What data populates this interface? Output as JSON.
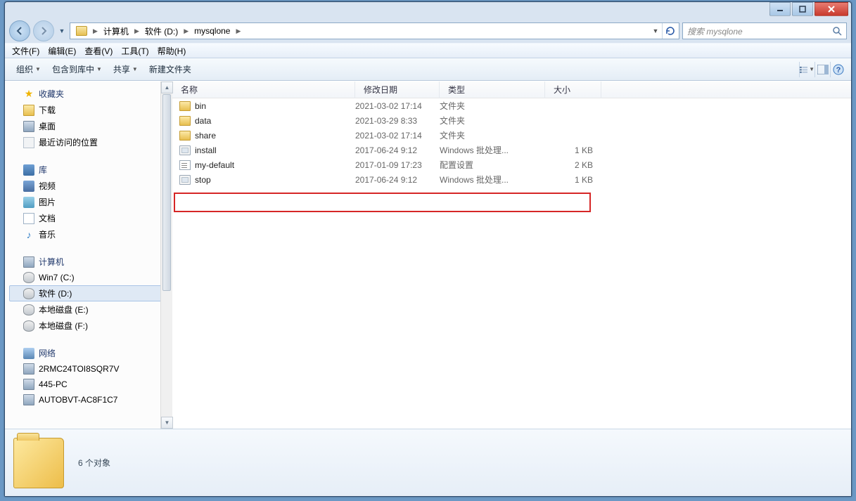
{
  "window": {
    "min": "—",
    "max": "☐",
    "close": "✕"
  },
  "nav": {
    "back": "◄",
    "fwd": "►"
  },
  "addr": {
    "root": "计算机",
    "drive": "软件 (D:)",
    "folder": "mysqlone"
  },
  "search": {
    "placeholder": "搜索 mysqlone"
  },
  "menu": {
    "file": "文件(F)",
    "edit": "编辑(E)",
    "view": "查看(V)",
    "tools": "工具(T)",
    "help": "帮助(H)"
  },
  "toolbar": {
    "organize": "组织",
    "include": "包含到库中",
    "share": "共享",
    "newfolder": "新建文件夹"
  },
  "sidebar": {
    "favorites": "收藏夹",
    "downloads": "下载",
    "desktop": "桌面",
    "recent": "最近访问的位置",
    "library": "库",
    "videos": "视频",
    "pictures": "图片",
    "documents": "文档",
    "music": "音乐",
    "computer": "计算机",
    "win7": "Win7 (C:)",
    "soft": "软件 (D:)",
    "local_e": "本地磁盘 (E:)",
    "local_f": "本地磁盘 (F:)",
    "network": "网络",
    "net1": "2RMC24TOI8SQR7V",
    "net2": "445-PC",
    "net3": "AUTOBVT-AC8F1C7"
  },
  "cols": {
    "name": "名称",
    "date": "修改日期",
    "type": "类型",
    "size": "大小"
  },
  "rows": [
    {
      "icon": "folder",
      "name": "bin",
      "date": "2021-03-02 17:14",
      "type": "文件夹",
      "size": ""
    },
    {
      "icon": "folder",
      "name": "data",
      "date": "2021-03-29 8:33",
      "type": "文件夹",
      "size": ""
    },
    {
      "icon": "folder",
      "name": "share",
      "date": "2021-03-02 17:14",
      "type": "文件夹",
      "size": ""
    },
    {
      "icon": "bat",
      "name": "install",
      "date": "2017-06-24 9:12",
      "type": "Windows 批处理...",
      "size": "1 KB"
    },
    {
      "icon": "ini",
      "name": "my-default",
      "date": "2017-01-09 17:23",
      "type": "配置设置",
      "size": "2 KB"
    },
    {
      "icon": "bat",
      "name": "stop",
      "date": "2017-06-24 9:12",
      "type": "Windows 批处理...",
      "size": "1 KB"
    }
  ],
  "status": {
    "text": "6 个对象"
  }
}
